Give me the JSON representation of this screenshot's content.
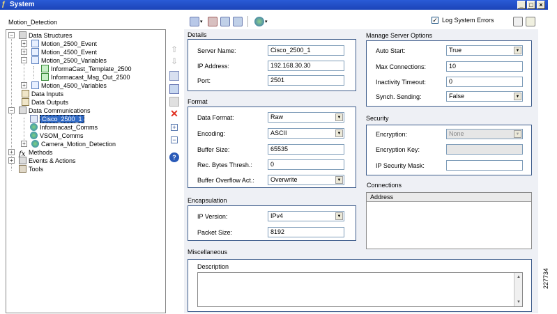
{
  "window": {
    "title": "System"
  },
  "tree": {
    "root_label": "Motion_Detection",
    "items": [
      {
        "label": "Data Structures"
      },
      {
        "label": "Motion_2500_Event"
      },
      {
        "label": "Motion_4500_Event"
      },
      {
        "label": "Motion_2500_Variables"
      },
      {
        "label": "InformaCast_Template_2500"
      },
      {
        "label": "Informacast_Msg_Out_2500"
      },
      {
        "label": "Motion_4500_Variables"
      },
      {
        "label": "Data Inputs"
      },
      {
        "label": "Data Outputs"
      },
      {
        "label": "Data Communications"
      },
      {
        "label": "Cisco_2500_1"
      },
      {
        "label": "Informacast_Comms"
      },
      {
        "label": "VSOM_Comms"
      },
      {
        "label": "Camera_Motion_Detection"
      },
      {
        "label": "Methods"
      },
      {
        "label": "Events & Actions"
      },
      {
        "label": "Tools"
      }
    ]
  },
  "toolbar": {
    "log_errors_label": "Log System Errors",
    "log_errors_checked": true
  },
  "details": {
    "title": "Details",
    "server_name_label": "Server Name:",
    "server_name_value": "Cisco_2500_1",
    "ip_label": "IP Address:",
    "ip_value": "192.168.30.30",
    "port_label": "Port:",
    "port_value": "2501"
  },
  "format": {
    "title": "Format",
    "data_format_label": "Data Format:",
    "data_format_value": "Raw",
    "encoding_label": "Encoding:",
    "encoding_value": "ASCII",
    "buffer_size_label": "Buffer Size:",
    "buffer_size_value": "65535",
    "rec_bytes_label": "Rec. Bytes Thresh.:",
    "rec_bytes_value": "0",
    "overflow_label": "Buffer Overflow Act.:",
    "overflow_value": "Overwrite"
  },
  "encapsulation": {
    "title": "Encapsulation",
    "ip_version_label": "IP Version:",
    "ip_version_value": "IPv4",
    "packet_size_label": "Packet Size:",
    "packet_size_value": "8192"
  },
  "server_options": {
    "title": "Manage Server Options",
    "auto_start_label": "Auto Start:",
    "auto_start_value": "True",
    "max_conn_label": "Max Connections:",
    "max_conn_value": "10",
    "inactivity_label": "Inactivity Timeout:",
    "inactivity_value": "0",
    "synch_label": "Synch. Sending:",
    "synch_value": "False"
  },
  "security": {
    "title": "Security",
    "encryption_label": "Encryption:",
    "encryption_value": "None",
    "key_label": "Encryption Key:",
    "key_value": "",
    "mask_label": "IP Security Mask:",
    "mask_value": ""
  },
  "connections": {
    "title": "Connections",
    "column_header": "Address"
  },
  "misc": {
    "title": "Miscellaneous",
    "description_label": "Description",
    "description_value": ""
  },
  "figure_id": "227734"
}
